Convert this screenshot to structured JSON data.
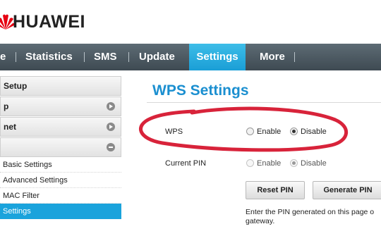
{
  "brand": {
    "name": "HUAWEI",
    "logo_color": "#e60012"
  },
  "nav": {
    "items": [
      {
        "label": "e"
      },
      {
        "label": "Statistics"
      },
      {
        "label": "SMS"
      },
      {
        "label": "Update"
      },
      {
        "label": "Settings",
        "active": true
      },
      {
        "label": "More"
      }
    ],
    "active_color": "#1a9ed6"
  },
  "sidebar": {
    "items": [
      {
        "label": "Setup",
        "type": "header"
      },
      {
        "label": "p",
        "type": "collapsed"
      },
      {
        "label": "net",
        "type": "collapsed"
      },
      {
        "label": "",
        "type": "expanded"
      },
      {
        "label": "Basic Settings",
        "type": "sub"
      },
      {
        "label": "Advanced Settings",
        "type": "sub"
      },
      {
        "label": "MAC Filter",
        "type": "sub"
      },
      {
        "label": "Settings",
        "type": "sub",
        "active": true
      }
    ]
  },
  "main": {
    "title": "WPS Settings",
    "wps": {
      "label": "WPS",
      "options": [
        "Enable",
        "Disable"
      ],
      "selected": "Disable"
    },
    "current_pin": {
      "label": "Current PIN",
      "options": [
        "Enable",
        "Disable"
      ],
      "selected": "Disable",
      "disabled": true
    },
    "buttons": {
      "reset_pin": "Reset PIN",
      "generate_pin": "Generate PIN"
    },
    "help_text": "Enter the PIN generated on this page o gateway."
  },
  "annotation": {
    "shape": "ellipse",
    "color": "#d8233a"
  }
}
